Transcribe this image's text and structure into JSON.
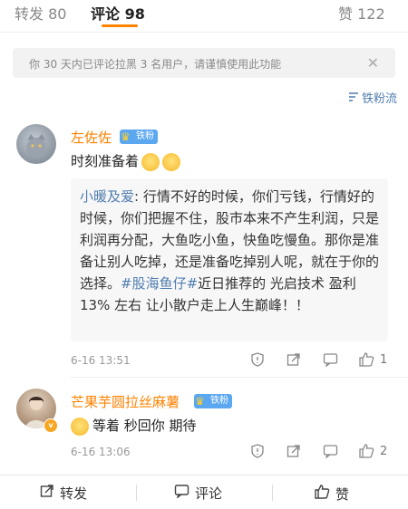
{
  "tabs": {
    "repost": "转发 80",
    "comment": "评论 98",
    "like": "赞 122"
  },
  "notice": {
    "text": "你 30 天内已评论拉黑 3 名用户，请谨慎使用此功能",
    "close": "✕"
  },
  "sort": {
    "label": "铁粉流",
    "icon": "sort-icon"
  },
  "comments": [
    {
      "user": "左佐佐",
      "badge": "铁粉",
      "text": "时刻准备着",
      "reply": {
        "user": "小暖及爱",
        "text_a": ": 行情不好的时候，你们亏钱，行情好的时候，你们把握不住，股市本来不产生利润，只是利润再分配，大鱼吃小鱼，快鱼吃慢鱼。那你是准备让别人吃掉，还是准备吃掉别人呢，就在于你的选择。",
        "hashtag": "#股海鱼仔#",
        "text_b": "近日推荐的 光启技术 盈利 13% 左右 让小散户走上人生巅峰！！"
      },
      "time": "6-16 13:51",
      "likes": "1"
    },
    {
      "user": "芒果芋圆拉丝麻薯",
      "badge": "铁粉",
      "text": "等着 秒回你 期待",
      "time": "6-16 13:06",
      "likes": "2"
    }
  ],
  "bottom": {
    "repost": "转发",
    "comment": "评论",
    "like": "赞"
  },
  "colors": {
    "accent": "#ff8200",
    "link": "#507daf",
    "badge": "#5ba8f0"
  }
}
